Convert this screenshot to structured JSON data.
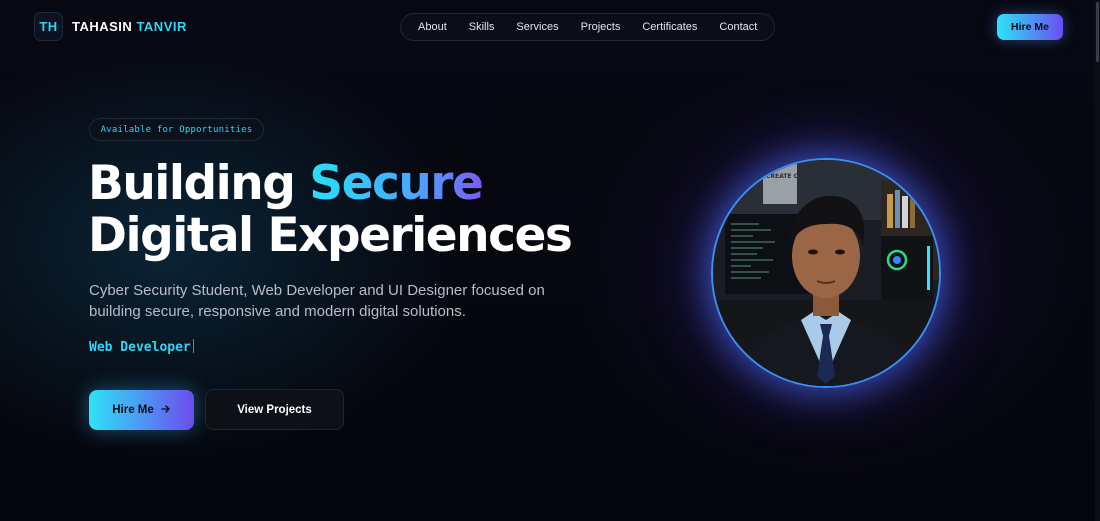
{
  "header": {
    "logo_badge": "TH",
    "logo_first": "TAHASIN",
    "logo_second": "TANVIR",
    "nav": [
      "About",
      "Skills",
      "Services",
      "Projects",
      "Certificates",
      "Contact"
    ],
    "hire_label": "Hire Me"
  },
  "hero": {
    "badge": "Available for Opportunities",
    "title_part1": "Building ",
    "title_highlight": "Secure",
    "title_line2": "Digital Experiences",
    "description": "Cyber Security Student, Web Developer and UI Designer focused on building secure, responsive and modern digital solutions.",
    "typed_role": "Web Developer",
    "primary_button": "Hire Me",
    "primary_button_icon": "arrow-right-icon",
    "secondary_button": "View Projects",
    "avatar_text": "CREATE CONQUER"
  },
  "colors": {
    "background": "#06070f",
    "accent_cyan": "#2fd6f5",
    "accent_purple": "#6c4cf0",
    "text_muted": "#b9bcc8"
  }
}
